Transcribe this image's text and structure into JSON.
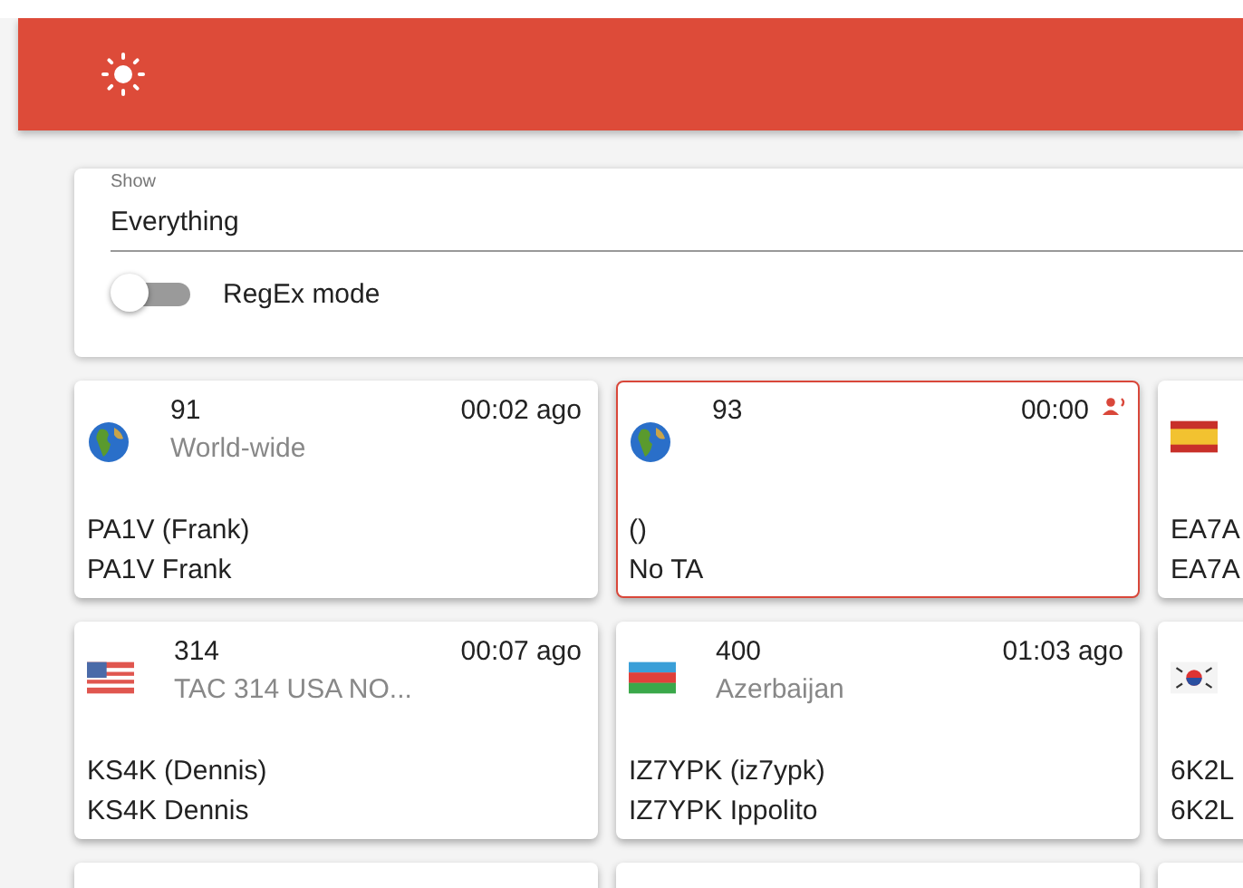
{
  "filter": {
    "label": "Show",
    "value": "Everything",
    "regex": {
      "label": "RegEx mode",
      "on": false
    }
  },
  "cards": [
    {
      "kind": "globe",
      "talkgroup": "91",
      "name": "World-wide",
      "time": "00:02 ago",
      "line1": "PA1V (Frank)",
      "line2": "PA1V Frank",
      "active": false
    },
    {
      "kind": "globe",
      "talkgroup": "93",
      "time": "00:00",
      "line1": "()",
      "line2": "No TA",
      "active": true
    },
    {
      "kind": "es",
      "line1": "EA7A",
      "line2": "EA7A",
      "active": false
    },
    {
      "kind": "us",
      "talkgroup": "314",
      "name": "TAC 314 USA NO...",
      "time": "00:07 ago",
      "line1": "KS4K (Dennis)",
      "line2": "KS4K Dennis",
      "active": false
    },
    {
      "kind": "az",
      "talkgroup": "400",
      "name": "Azerbaijan",
      "time": "01:03 ago",
      "line1": "IZ7YPK (iz7ypk)",
      "line2": "IZ7YPK Ippolito",
      "active": false
    },
    {
      "kind": "kr",
      "line1": "6K2L",
      "line2": "6K2L",
      "active": false
    }
  ]
}
